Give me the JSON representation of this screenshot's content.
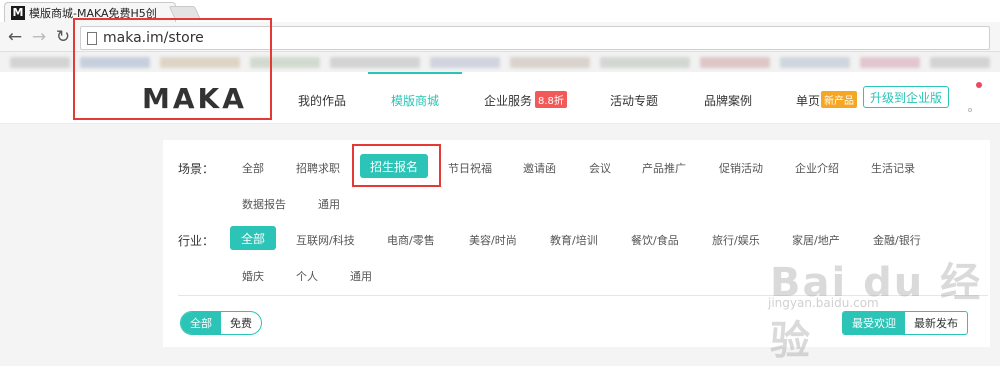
{
  "browser": {
    "tab_title": "模版商城-MAKA免费H5创",
    "favicon": "M",
    "url": "maka.im/store"
  },
  "header": {
    "logo": "MAKA",
    "nav": [
      "我的作品",
      "模版商城",
      "企业服务",
      "活动专题",
      "品牌案例",
      "单页"
    ],
    "enterprise_badge": "8.8折",
    "page_badge": "新产品",
    "upgrade": "升级到企业版"
  },
  "filters": {
    "scene_label": "场景：",
    "scenes": [
      "全部",
      "招聘求职",
      "招生报名",
      "节日祝福",
      "邀请函",
      "会议",
      "产品推广",
      "促销活动",
      "企业介绍",
      "生活记录",
      "数据报告",
      "通用"
    ],
    "industry_label": "行业：",
    "industries": [
      "全部",
      "互联网/科技",
      "电商/零售",
      "美容/时尚",
      "教育/培训",
      "餐饮/食品",
      "旅行/娱乐",
      "家居/地产",
      "金融/银行",
      "婚庆",
      "个人",
      "通用"
    ]
  },
  "price_toggle": [
    "全部",
    "免费"
  ],
  "sort": [
    "最受欢迎",
    "最新发布"
  ],
  "watermark": {
    "main": "Bai du 经验",
    "sub": "jingyan.baidu.com"
  },
  "colors": {
    "accent": "#2bc4b6",
    "highlight": "#e53935",
    "badge_red": "#f25a5a",
    "badge_orange": "#f5a623"
  }
}
